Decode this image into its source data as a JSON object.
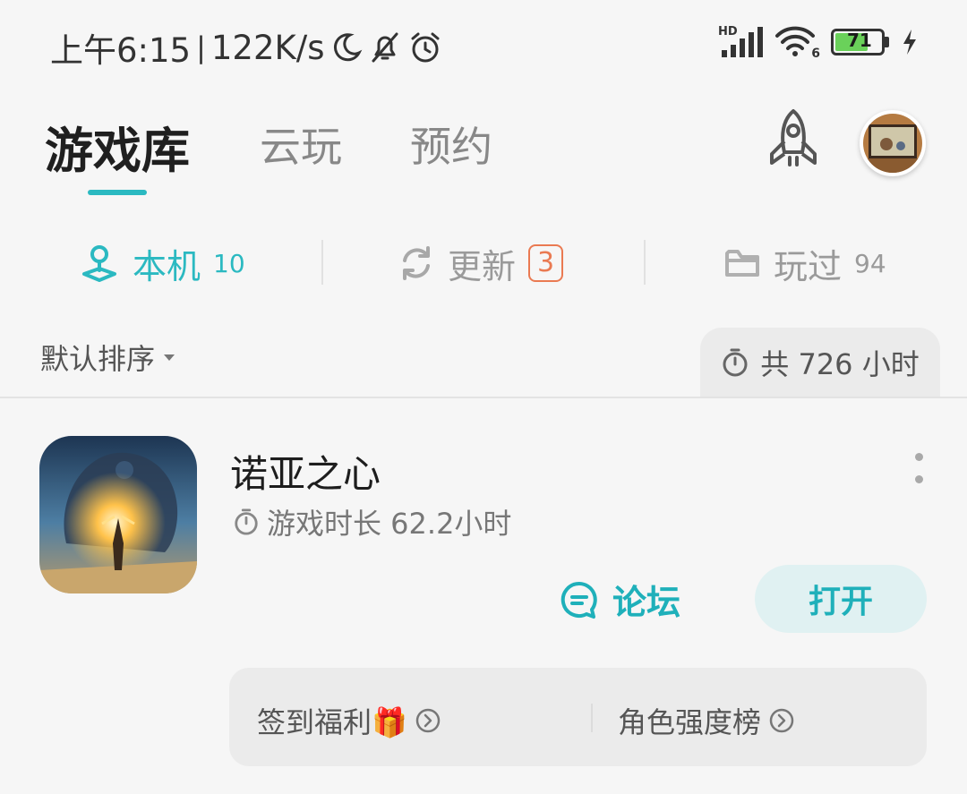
{
  "status_bar": {
    "time": "上午6:15",
    "speed": "122K/s",
    "network_badge": "HD",
    "wifi_sub": "6",
    "battery": "71"
  },
  "header": {
    "tabs": [
      {
        "label": "游戏库",
        "active": true
      },
      {
        "label": "云玩",
        "active": false
      },
      {
        "label": "预约",
        "active": false
      }
    ]
  },
  "subtabs": [
    {
      "label": "本机",
      "count": "10"
    },
    {
      "label": "更新",
      "count": "3"
    },
    {
      "label": "玩过",
      "count": "94"
    }
  ],
  "sort": {
    "label": "默认排序",
    "total": "共 726 小时"
  },
  "game": {
    "title": "诺亚之心",
    "playtime": "游戏时长 62.2小时",
    "forum_label": "论坛",
    "open_label": "打开",
    "extras": [
      {
        "label": "签到福利🎁"
      },
      {
        "label": "角色强度榜"
      }
    ]
  },
  "colors": {
    "accent": "#2bb9c1",
    "badge": "#ea7a52",
    "battery_fill": "#6ad15a"
  }
}
